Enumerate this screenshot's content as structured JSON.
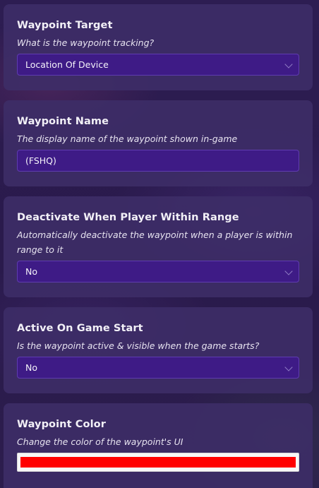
{
  "waypoint_target": {
    "title": "Waypoint Target",
    "description": "What is the waypoint tracking?",
    "value": "Location Of Device"
  },
  "waypoint_name": {
    "title": "Waypoint Name",
    "description": "The display name of the waypoint shown in-game",
    "value": "(FSHQ)"
  },
  "deactivate_range": {
    "title": "Deactivate When Player Within Range",
    "description": "Automatically deactivate the waypoint when a player is within range to it",
    "value": "No"
  },
  "active_on_start": {
    "title": "Active On Game Start",
    "description": "Is the waypoint active & visible when the game starts?",
    "value": "No"
  },
  "waypoint_color": {
    "title": "Waypoint Color",
    "description": "Change the color of the waypoint's UI",
    "value": "#ff0000"
  },
  "icons": {
    "dropdown": "chevron-down-icon"
  }
}
